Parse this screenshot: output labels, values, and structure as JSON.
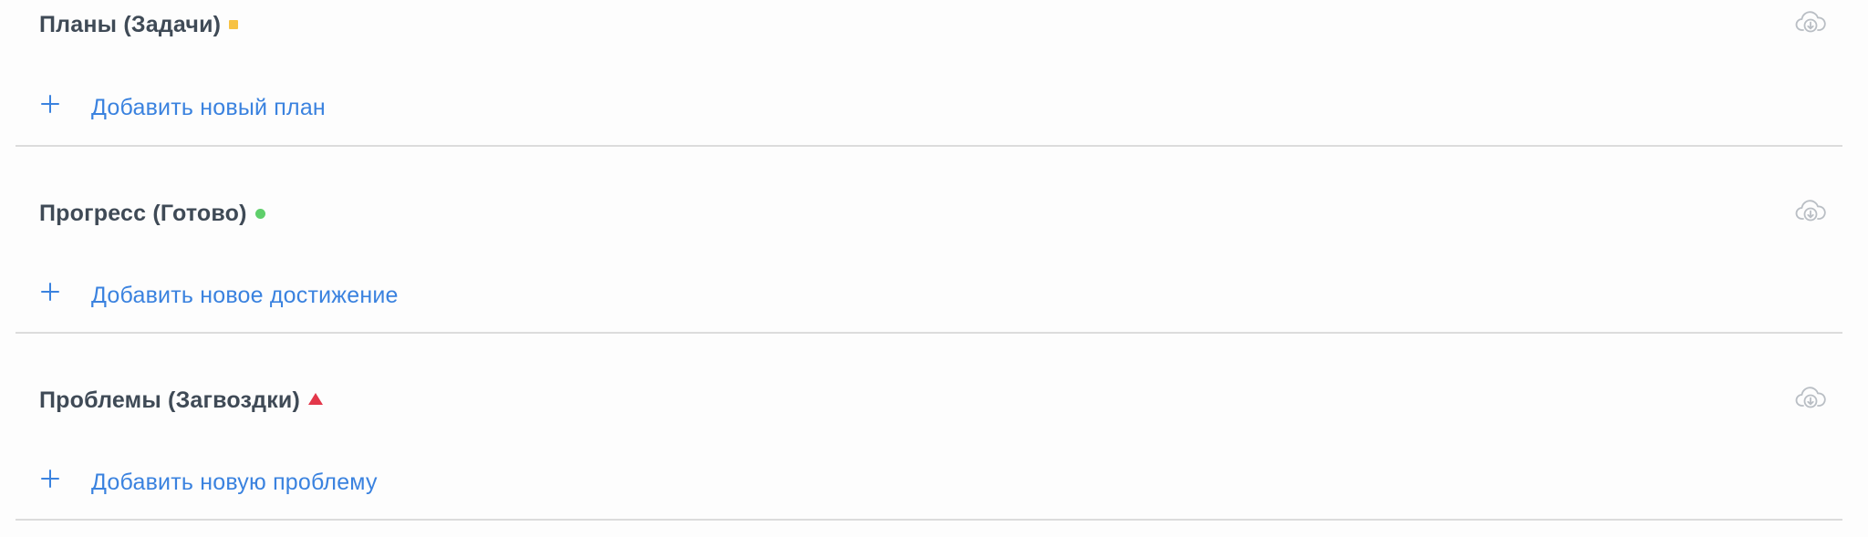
{
  "sections": [
    {
      "title": "Планы (Задачи)",
      "status_icon": "yellow-square",
      "status_color": "#f7c244",
      "add_label": "Добавить новый план",
      "action_icon": "cloud-download-icon"
    },
    {
      "title": "Прогресс (Готово)",
      "status_icon": "green-dot",
      "status_color": "#5fcf6b",
      "add_label": "Добавить новое достижение",
      "action_icon": "cloud-download-icon"
    },
    {
      "title": "Проблемы (Загвоздки)",
      "status_icon": "red-triangle",
      "status_color": "#e3374a",
      "add_label": "Добавить новую проблему",
      "action_icon": "cloud-download-icon"
    }
  ],
  "colors": {
    "link": "#3a82df",
    "title": "#3f4a56",
    "divider": "#dcdcdc",
    "icon_muted": "#b9bec4"
  }
}
